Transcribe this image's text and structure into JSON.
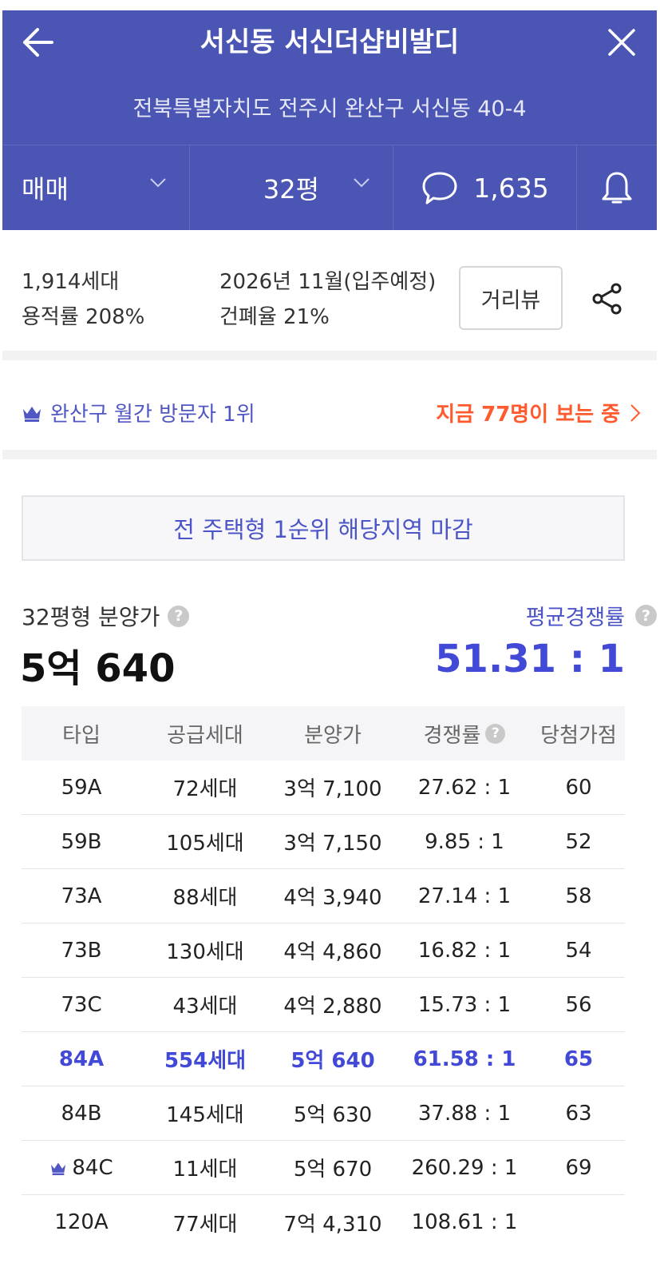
{
  "header": {
    "title": "서신동 서신더샵비발디",
    "address": "전북특별자치도 전주시 완산구 서신동 40-4",
    "tabs": {
      "deal": "매매",
      "size": "32평",
      "comment_count": "1,635"
    },
    "icons": [
      "arrow-left-icon",
      "close-icon",
      "chevron-down-icon",
      "speech-bubble-icon",
      "bell-icon"
    ]
  },
  "info": {
    "households": "1,914세대",
    "far": "용적률 208%",
    "move_in": "2026년 11월(입주예정)",
    "bcr": "건폐율 21%",
    "street_view_label": "거리뷰"
  },
  "rank": {
    "left": "완산구 월간 방문자 1위",
    "right": "지금 77명이 보는 중"
  },
  "notice": "전 주택형 1순위 해당지역 마감",
  "summary": {
    "price_label": "32평형 분양가",
    "price_value": "5억 640",
    "comp_label": "평균경쟁률",
    "comp_value": "51.31 : 1",
    "help_glyph": "?"
  },
  "table": {
    "headers": [
      "타입",
      "공급세대",
      "분양가",
      "경쟁률",
      "당첨가점"
    ],
    "rows": [
      [
        "59A",
        "72세대",
        "3억 7,100",
        "27.62 : 1",
        "60"
      ],
      [
        "59B",
        "105세대",
        "3억 7,150",
        "9.85 : 1",
        "52"
      ],
      [
        "73A",
        "88세대",
        "4억 3,940",
        "27.14 : 1",
        "58"
      ],
      [
        "73B",
        "130세대",
        "4억 4,860",
        "16.82 : 1",
        "54"
      ],
      [
        "73C",
        "43세대",
        "4억 2,880",
        "15.73 : 1",
        "56"
      ],
      [
        "84A",
        "554세대",
        "5억 640",
        "61.58 : 1",
        "65"
      ],
      [
        "84B",
        "145세대",
        "5억 630",
        "37.88 : 1",
        "63"
      ],
      [
        "84C",
        "11세대",
        "5억 670",
        "260.29 : 1",
        "69"
      ],
      [
        "120A",
        "77세대",
        "7억 4,310",
        "108.61 : 1",
        ""
      ]
    ]
  },
  "colors": {
    "header_bg": "#4b55b4",
    "accent": "#4149d6",
    "hot": "#ff5a2d"
  }
}
